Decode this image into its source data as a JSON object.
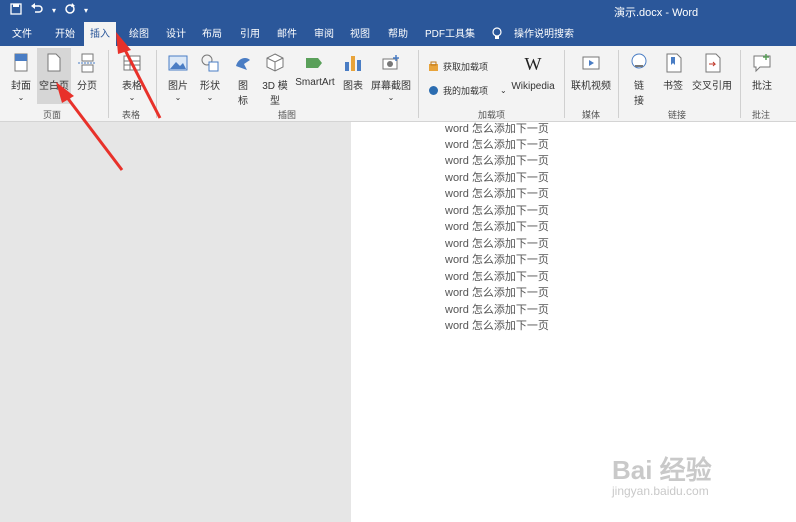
{
  "window": {
    "title": "演示.docx - Word"
  },
  "qat": {
    "save_icon": "save-icon",
    "undo_icon": "undo-icon",
    "redo_icon": "redo-icon",
    "more": "▾"
  },
  "tabs": [
    {
      "label": "文件"
    },
    {
      "label": "开始"
    },
    {
      "label": "插入"
    },
    {
      "label": "绘图"
    },
    {
      "label": "设计"
    },
    {
      "label": "布局"
    },
    {
      "label": "引用"
    },
    {
      "label": "邮件"
    },
    {
      "label": "审阅"
    },
    {
      "label": "视图"
    },
    {
      "label": "帮助"
    },
    {
      "label": "PDF工具集"
    },
    {
      "label": "操作说明搜索"
    }
  ],
  "ribbon": {
    "pages": {
      "cover": "封面",
      "blank": "空白页",
      "break": "分页",
      "group": "页面"
    },
    "tables": {
      "table": "表格",
      "group": "表格"
    },
    "illustrations": {
      "picture": "图片",
      "shapes": "形状",
      "icons_1": "图",
      "icons_2": "标",
      "model_1": "3D 模",
      "model_2": "型",
      "smartart": "SmartArt",
      "chart": "图表",
      "screenshot": "屏幕截图",
      "group": "插图"
    },
    "addins": {
      "get": "获取加载项",
      "my": "我的加载项",
      "wikipedia": "Wikipedia",
      "group": "加载项"
    },
    "media": {
      "video": "联机视频",
      "group": "媒体"
    },
    "links": {
      "link_1": "链",
      "link_2": "接",
      "bookmark": "书签",
      "crossref": "交叉引用",
      "group": "链接"
    },
    "comments": {
      "comment": "批注",
      "group": "批注"
    }
  },
  "document": {
    "lines": [
      "word 怎么添加下一页",
      "word 怎么添加下一页",
      "word 怎么添加下一页",
      "word 怎么添加下一页",
      "word 怎么添加下一页",
      "word 怎么添加下一页",
      "word 怎么添加下一页",
      "word 怎么添加下一页",
      "word 怎么添加下一页",
      "word 怎么添加下一页",
      "word 怎么添加下一页",
      "word 怎么添加下一页",
      "word 怎么添加下一页"
    ]
  },
  "watermark": {
    "logo": "Bai 经验",
    "url": "jingyan.baidu.com"
  },
  "colors": {
    "title_bar": "#2b579a",
    "ribbon": "#f3f3f3",
    "annotation_arrow": "#e8312a"
  }
}
